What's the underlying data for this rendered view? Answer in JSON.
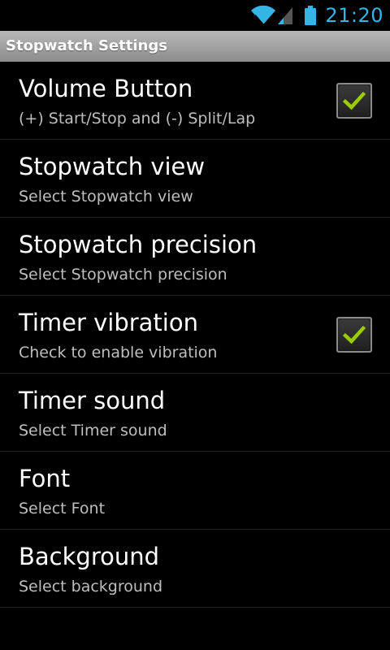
{
  "status_bar": {
    "time": "21:20",
    "icons": [
      "wifi-icon",
      "signal-icon",
      "battery-icon"
    ],
    "accent_color": "#33b5e5"
  },
  "title_bar": {
    "title": "Stopwatch Settings"
  },
  "settings": [
    {
      "title": "Volume Button",
      "summary": "(+) Start/Stop and (-) Split/Lap",
      "checkbox": true,
      "checked": true
    },
    {
      "title": "Stopwatch view",
      "summary": "Select Stopwatch view",
      "checkbox": false
    },
    {
      "title": "Stopwatch precision",
      "summary": "Select Stopwatch precision",
      "checkbox": false
    },
    {
      "title": "Timer vibration",
      "summary": "Check to enable vibration",
      "checkbox": true,
      "checked": true
    },
    {
      "title": "Timer sound",
      "summary": "Select Timer sound",
      "checkbox": false
    },
    {
      "title": "Font",
      "summary": "Select Font",
      "checkbox": false
    },
    {
      "title": "Background",
      "summary": "Select background",
      "checkbox": false
    }
  ],
  "colors": {
    "check_mark": "#99cc00",
    "summary_text": "#bebebe"
  }
}
